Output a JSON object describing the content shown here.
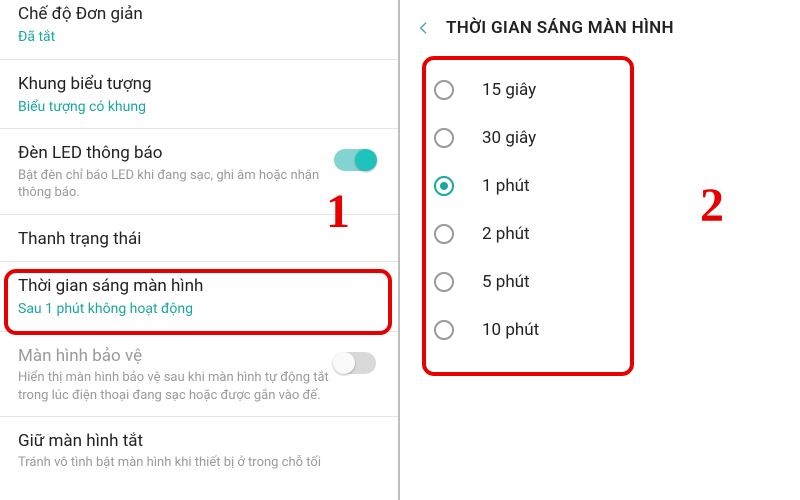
{
  "annotations": {
    "step1": "1",
    "step2": "2"
  },
  "left_pane": {
    "rows": [
      {
        "title": "Chế độ Đơn giản",
        "sub": "Đã tắt",
        "sub_style": "teal",
        "has_toggle": false
      },
      {
        "title": "Khung biểu tượng",
        "sub": "Biểu tượng có khung",
        "sub_style": "teal",
        "has_toggle": false
      },
      {
        "title": "Đèn LED thông báo",
        "desc": "Bật đèn chỉ báo LED khi đang sạc, ghi âm hoặc nhận thông báo.",
        "has_toggle": true,
        "toggle_on": true
      },
      {
        "title": "Thanh trạng thái",
        "has_toggle": false
      },
      {
        "title": "Thời gian sáng màn hình",
        "sub": "Sau 1 phút không hoạt động",
        "sub_style": "teal",
        "has_toggle": false,
        "highlighted": true
      },
      {
        "title": "Màn hình bảo vệ",
        "desc": "Hiển thị màn hình bảo vệ sau khi màn hình tự động tắt trong lúc điện thoại đang sạc hoặc được gắn vào đế.",
        "has_toggle": true,
        "toggle_on": false
      },
      {
        "title": "Giữ màn hình tắt",
        "desc": "Tránh vô tình bật màn hình khi thiết bị ở trong chỗ tối",
        "has_toggle": true,
        "toggle_on": false
      }
    ]
  },
  "right_pane": {
    "header": "THỜI GIAN SÁNG MÀN HÌNH",
    "options": [
      {
        "label": "15 giây",
        "selected": false
      },
      {
        "label": "30 giây",
        "selected": false
      },
      {
        "label": "1 phút",
        "selected": true
      },
      {
        "label": "2 phút",
        "selected": false
      },
      {
        "label": "5 phút",
        "selected": false
      },
      {
        "label": "10 phút",
        "selected": false
      }
    ]
  }
}
